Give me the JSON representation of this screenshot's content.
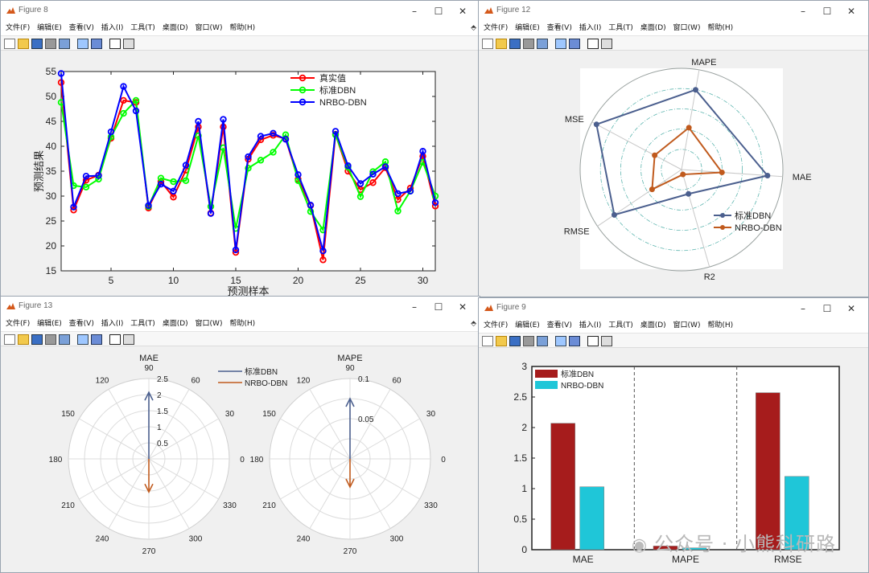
{
  "menu_items": [
    "文件(F)",
    "编辑(E)",
    "查看(V)",
    "插入(I)",
    "工具(T)",
    "桌面(D)",
    "窗口(W)",
    "帮助(H)"
  ],
  "figure8": {
    "title": "Figure 8",
    "chart_data": {
      "type": "line",
      "x": [
        1,
        2,
        3,
        4,
        5,
        6,
        7,
        8,
        9,
        10,
        11,
        12,
        13,
        14,
        15,
        16,
        17,
        18,
        19,
        20,
        21,
        22,
        23,
        24,
        25,
        26,
        27,
        28,
        29,
        30,
        31
      ],
      "series": [
        {
          "name": "真实值",
          "color": "#ff0000",
          "values": [
            52.8,
            27.2,
            33.2,
            34.2,
            41.6,
            49.2,
            48.8,
            27.6,
            32.9,
            29.8,
            35.2,
            43.9,
            26.6,
            43.9,
            18.7,
            37.4,
            41.3,
            42.2,
            41.5,
            33.4,
            28.1,
            17.2,
            42.4,
            35.0,
            31.3,
            32.7,
            35.7,
            29.3,
            31.6,
            38.0,
            28.0
          ]
        },
        {
          "name": "标准DBN",
          "color": "#00ff00",
          "values": [
            48.8,
            32.1,
            31.8,
            33.4,
            41.9,
            46.6,
            49.2,
            27.9,
            33.6,
            32.9,
            33.1,
            42.1,
            27.9,
            39.7,
            23.5,
            35.6,
            37.2,
            38.8,
            42.3,
            33.1,
            26.9,
            23.2,
            42.3,
            35.8,
            29.9,
            34.9,
            36.9,
            27.0,
            31.0,
            36.8,
            30.0
          ]
        },
        {
          "name": "NRBO-DBN",
          "color": "#0000ff",
          "values": [
            54.6,
            27.8,
            34.0,
            34.1,
            42.9,
            52.0,
            47.1,
            28.1,
            32.4,
            31.0,
            36.2,
            45.0,
            26.5,
            45.4,
            19.2,
            37.9,
            42.0,
            42.6,
            41.4,
            34.3,
            28.2,
            19.0,
            43.0,
            36.1,
            32.5,
            34.4,
            35.9,
            30.5,
            31.0,
            39.0,
            28.7
          ]
        }
      ],
      "xlabel": "预测样本",
      "ylabel": "预测结果",
      "xlim": [
        1,
        31
      ],
      "ylim": [
        15,
        55
      ],
      "xticks": [
        5,
        10,
        15,
        20,
        25,
        30
      ],
      "yticks": [
        15,
        20,
        25,
        30,
        35,
        40,
        45,
        50,
        55
      ],
      "legend_position": "top-right"
    }
  },
  "figure12": {
    "title": "Figure 12",
    "chart_data": {
      "type": "radar",
      "axes": [
        "MAE",
        "MAPE",
        "MSE",
        "RMSE",
        "R2"
      ],
      "series": [
        {
          "name": "标准DBN",
          "color": "#4b5f8e",
          "values": [
            0.85,
            0.8,
            0.95,
            0.8,
            0.25
          ]
        },
        {
          "name": "NRBO-DBN",
          "color": "#c05a1d",
          "values": [
            0.4,
            0.42,
            0.3,
            0.35,
            0.05
          ]
        }
      ],
      "legend_position": "bottom-right"
    }
  },
  "figure13": {
    "title": "Figure 13",
    "chart_data": [
      {
        "type": "compass",
        "title": "MAE",
        "r_ticks": [
          "0.5",
          "1",
          "1.5",
          "2",
          "2.5"
        ],
        "r_max": 2.5,
        "angle_labels": [
          "90",
          "60",
          "30",
          "0",
          "330",
          "300",
          "270",
          "240",
          "210",
          "180",
          "150",
          "120"
        ],
        "series": [
          {
            "name": "标准DBN",
            "color": "#4b5f8e",
            "value": 2.07
          },
          {
            "name": "NRBO-DBN",
            "color": "#c05a1d",
            "value": 1.03
          }
        ]
      },
      {
        "type": "compass",
        "title": "MAPE",
        "r_ticks": [
          "0.05",
          "0.1"
        ],
        "r_max": 0.1,
        "angle_labels": [
          "90",
          "60",
          "30",
          "0",
          "330",
          "300",
          "270",
          "240",
          "210",
          "180",
          "150",
          "120"
        ],
        "series": [
          {
            "name": "标准DBN",
            "color": "#4b5f8e",
            "value": 0.075
          },
          {
            "name": "NRBO-DBN",
            "color": "#c05a1d",
            "value": 0.035
          }
        ]
      }
    ]
  },
  "figure9": {
    "title": "Figure 9",
    "chart_data": {
      "type": "bar",
      "categories": [
        "MAE",
        "MAPE",
        "RMSE"
      ],
      "series": [
        {
          "name": "标准DBN",
          "color": "#a61c1c",
          "values": [
            2.07,
            0.06,
            2.57
          ]
        },
        {
          "name": "NRBO-DBN",
          "color": "#1fc6d8",
          "values": [
            1.03,
            0.03,
            1.2
          ]
        }
      ],
      "ylim": [
        0,
        3
      ],
      "yticks": [
        "0",
        "0.5",
        "1",
        "1.5",
        "2",
        "2.5",
        "3"
      ],
      "legend_position": "top-left"
    }
  },
  "watermark": "公众号 · 小熊科研路"
}
